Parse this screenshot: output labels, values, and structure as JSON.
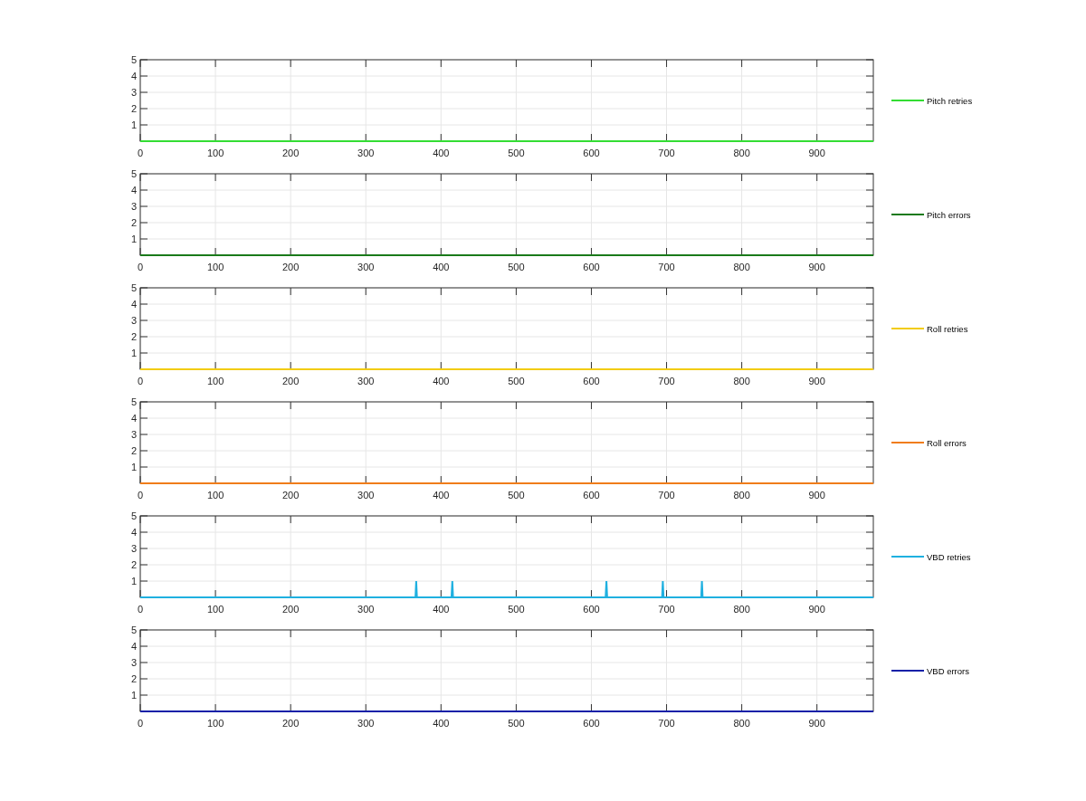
{
  "charts": [
    {
      "chart_data": {
        "type": "line",
        "x": [
          0,
          975
        ],
        "xlim": [
          0,
          975
        ],
        "ylim": [
          0,
          5
        ],
        "xticks": [
          0,
          100,
          200,
          300,
          400,
          500,
          600,
          700,
          800,
          900
        ],
        "yticks": [
          1,
          2,
          3,
          4,
          5
        ],
        "grid": true,
        "series": [
          {
            "name": "Pitch retries",
            "color": "#33dd33",
            "values": [
              0,
              0
            ]
          }
        ]
      }
    },
    {
      "chart_data": {
        "type": "line",
        "x": [
          0,
          975
        ],
        "xlim": [
          0,
          975
        ],
        "ylim": [
          0,
          5
        ],
        "xticks": [
          0,
          100,
          200,
          300,
          400,
          500,
          600,
          700,
          800,
          900
        ],
        "yticks": [
          1,
          2,
          3,
          4,
          5
        ],
        "grid": true,
        "series": [
          {
            "name": "Pitch errors",
            "color": "#1a7a1a",
            "values": [
              0,
              0
            ]
          }
        ]
      }
    },
    {
      "chart_data": {
        "type": "line",
        "x": [
          0,
          975
        ],
        "xlim": [
          0,
          975
        ],
        "ylim": [
          0,
          5
        ],
        "xticks": [
          0,
          100,
          200,
          300,
          400,
          500,
          600,
          700,
          800,
          900
        ],
        "yticks": [
          1,
          2,
          3,
          4,
          5
        ],
        "grid": true,
        "series": [
          {
            "name": "Roll retries",
            "color": "#f2cc10",
            "values": [
              0,
              0
            ]
          }
        ]
      }
    },
    {
      "chart_data": {
        "type": "line",
        "x": [
          0,
          975
        ],
        "xlim": [
          0,
          975
        ],
        "ylim": [
          0,
          5
        ],
        "xticks": [
          0,
          100,
          200,
          300,
          400,
          500,
          600,
          700,
          800,
          900
        ],
        "yticks": [
          1,
          2,
          3,
          4,
          5
        ],
        "grid": true,
        "series": [
          {
            "name": "Roll errors",
            "color": "#f07d1a",
            "values": [
              0,
              0
            ]
          }
        ]
      }
    },
    {
      "chart_data": {
        "type": "line",
        "x": [
          0,
          366,
          367,
          368,
          414,
          415,
          416,
          619,
          620,
          621,
          694,
          695,
          696,
          746,
          747,
          748,
          975
        ],
        "xlim": [
          0,
          975
        ],
        "ylim": [
          0,
          5
        ],
        "xticks": [
          0,
          100,
          200,
          300,
          400,
          500,
          600,
          700,
          800,
          900
        ],
        "yticks": [
          1,
          2,
          3,
          4,
          5
        ],
        "grid": true,
        "series": [
          {
            "name": "VBD retries",
            "color": "#1fb0e0",
            "values": [
              0,
              0,
              1,
              0,
              0,
              1,
              0,
              0,
              1,
              0,
              0,
              1,
              0,
              0,
              1,
              0,
              0
            ]
          }
        ]
      }
    },
    {
      "chart_data": {
        "type": "line",
        "x": [
          0,
          975
        ],
        "xlim": [
          0,
          975
        ],
        "ylim": [
          0,
          5
        ],
        "xticks": [
          0,
          100,
          200,
          300,
          400,
          500,
          600,
          700,
          800,
          900
        ],
        "yticks": [
          1,
          2,
          3,
          4,
          5
        ],
        "grid": true,
        "series": [
          {
            "name": "VBD errors",
            "color": "#1020a8",
            "values": [
              0,
              0
            ]
          }
        ]
      }
    }
  ]
}
